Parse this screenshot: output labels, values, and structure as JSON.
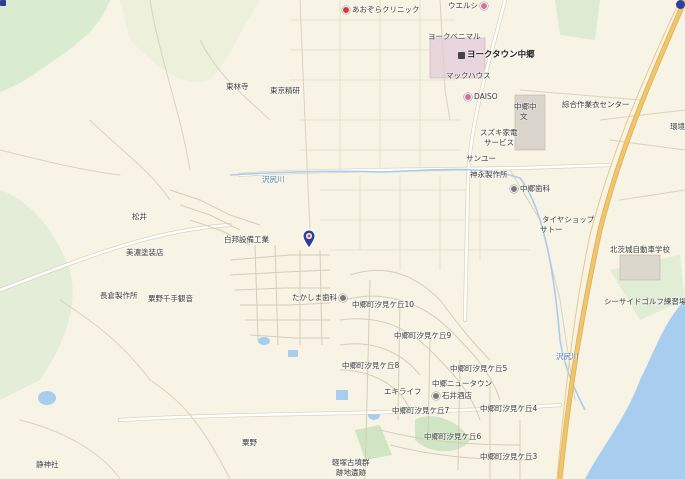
{
  "map": {
    "colors": {
      "land": "#f7f4e6",
      "forest": "#d9ecd0",
      "water": "#a8cdee",
      "road": "#ffffff",
      "road_outline": "#d8d2bb",
      "highway": "#f3c56a",
      "pin": "#2d3f9a"
    },
    "labels": {
      "aozora_clinic": "あおぞらクリニック",
      "welcia": "ウエルシ",
      "yorkbenimaru": "ヨークベニマル",
      "yorktown": "ヨークタウン中郷",
      "mac_house": "マックハウス",
      "daiso": "DAISO",
      "nakago_jh": "中郷中",
      "bun": "文",
      "sogo_sagyoi": "綜合作業衣センター",
      "suzuki_kaden": "スズキ家電",
      "service": "サービス",
      "sanyu": "サンユー",
      "jinei_seisakusho": "神永製作所",
      "nakago_dental": "中郷歯科",
      "tire_shop": "タイヤショップ",
      "satou": "サトー",
      "tokurin": "東林寺",
      "toukyo_seiken": "東京精研",
      "sawaba_river_1": "沢尻川",
      "matsui": "松井",
      "hakuhou_setsubi": "白邦設備工業",
      "mishima_tosou": "美濃塗装店",
      "nagakura_seisakusho": "長倉製作所",
      "kurino_kannon": "粟野千手観音",
      "takashima_dental": "たかしま歯科",
      "shiomigaoka10": "中郷町汐見ケ丘10",
      "shiomigaoka9": "中郷町汐見ケ丘9",
      "shiomigaoka8": "中郷町汐見ケ丘8",
      "shiomigaoka5": "中郷町汐見ケ丘5",
      "shiomigaoka7": "中郷町汐見ケ丘7",
      "shiomigaoka4": "中郷町汐見ケ丘4",
      "shiomigaoka6": "中郷町汐見ケ丘6",
      "shiomigaoka3": "中郷町汐見ケ丘3",
      "nakago_newtown": "中郷ニュータウン",
      "ishii_saketen": "石井酒店",
      "ekilife": "エキライフ",
      "sawaba_river_2": "沢尻川",
      "kitaibaraki_driving": "北茨城自動車学校",
      "seaside_golf": "シーサイドゴルフ練習場",
      "kankyo": "環境",
      "kurino": "粟野",
      "shizu_shrine": "静神社",
      "ruins_1": "軽塚古墳群",
      "ruins_2": "跡地遺跡"
    },
    "icons": {
      "pin": "dental-pin-icon",
      "building": "building-icon"
    }
  }
}
